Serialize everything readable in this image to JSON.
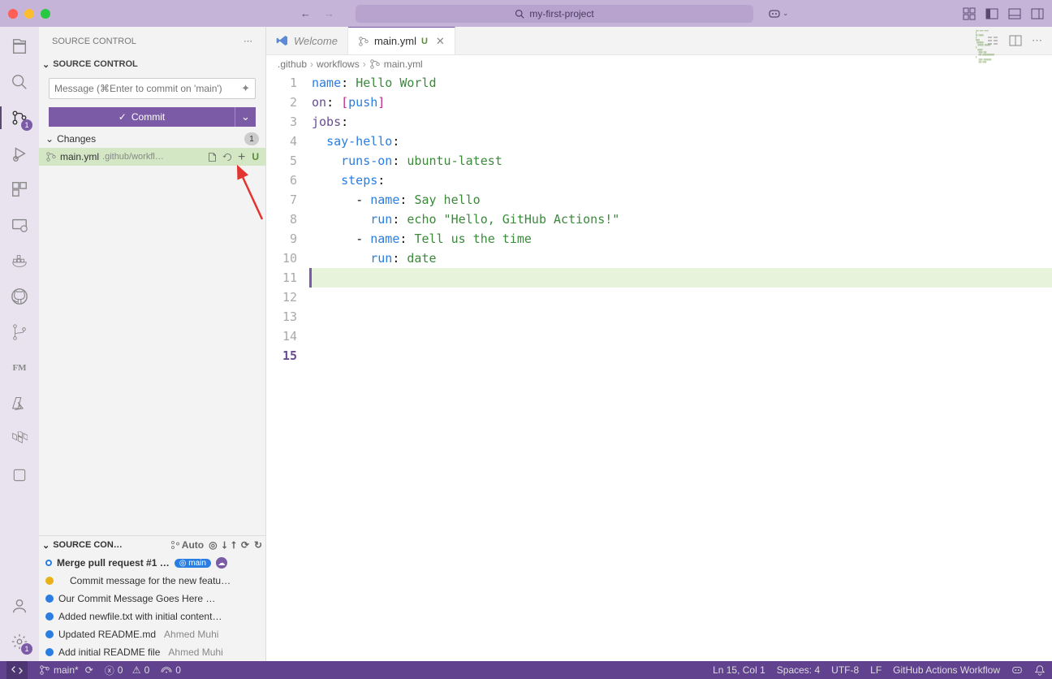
{
  "title": {
    "project": "my-first-project"
  },
  "tabs": {
    "welcome": "Welcome",
    "file": "main.yml",
    "file_status": "U"
  },
  "breadcrumb": {
    "a": ".github",
    "b": "workflows",
    "c": "main.yml"
  },
  "sidebar": {
    "title": "SOURCE CONTROL",
    "section": "SOURCE CONTROL",
    "msg_placeholder": "Message (⌘Enter to commit on 'main')",
    "commit_label": "Commit",
    "changes_label": "Changes",
    "changes_count": "1",
    "file": {
      "name": "main.yml",
      "path": ".github/workfl…",
      "status": "U"
    },
    "graph_title": "SOURCE CON…",
    "auto": "Auto",
    "commits": [
      {
        "msg": "Merge pull request #1 …",
        "dot": "hollow",
        "badge": "main"
      },
      {
        "msg": "Commit message for the new featu…",
        "dot": "yellow"
      },
      {
        "msg": "Our Commit Message Goes Here …",
        "dot": "blue"
      },
      {
        "msg": "Added newfile.txt with initial content…",
        "dot": "blue"
      },
      {
        "msg": "Updated README.md",
        "dot": "blue",
        "author": "Ahmed Muhi"
      },
      {
        "msg": "Add initial README file",
        "dot": "blue",
        "author": "Ahmed Muhi"
      }
    ]
  },
  "activity_badge": "1",
  "editor": {
    "lines": [
      [
        [
          "k-key",
          "name"
        ],
        [
          "k-punc",
          ": "
        ],
        [
          "k-str",
          "Hello World"
        ]
      ],
      [],
      [
        [
          "k-fn",
          "on"
        ],
        [
          "k-punc",
          ": "
        ],
        [
          "k-br",
          "["
        ],
        [
          "k-key",
          "push"
        ],
        [
          "k-br",
          "]"
        ]
      ],
      [],
      [
        [
          "k-fn",
          "jobs"
        ],
        [
          "k-punc",
          ":"
        ]
      ],
      [
        [
          "",
          "  "
        ],
        [
          "k-key",
          "say-hello"
        ],
        [
          "k-punc",
          ":"
        ]
      ],
      [
        [
          "",
          "    "
        ],
        [
          "k-key",
          "runs-on"
        ],
        [
          "k-punc",
          ": "
        ],
        [
          "k-str",
          "ubuntu-latest"
        ]
      ],
      [],
      [
        [
          "",
          "    "
        ],
        [
          "k-key",
          "steps"
        ],
        [
          "k-punc",
          ":"
        ]
      ],
      [
        [
          "",
          "      "
        ],
        [
          "k-punc",
          "- "
        ],
        [
          "k-key",
          "name"
        ],
        [
          "k-punc",
          ": "
        ],
        [
          "k-str",
          "Say hello"
        ]
      ],
      [
        [
          "",
          "        "
        ],
        [
          "k-key",
          "run"
        ],
        [
          "k-punc",
          ": "
        ],
        [
          "k-str",
          "echo \"Hello, GitHub Actions!\""
        ]
      ],
      [],
      [
        [
          "",
          "      "
        ],
        [
          "k-punc",
          "- "
        ],
        [
          "k-key",
          "name"
        ],
        [
          "k-punc",
          ": "
        ],
        [
          "k-str",
          "Tell us the time"
        ]
      ],
      [
        [
          "",
          "        "
        ],
        [
          "k-key",
          "run"
        ],
        [
          "k-punc",
          ": "
        ],
        [
          "k-str",
          "date"
        ]
      ],
      []
    ],
    "current_line": 15
  },
  "statusbar": {
    "branch": "main*",
    "errors": "0",
    "warnings": "0",
    "ports": "0",
    "cursor": "Ln 15, Col 1",
    "spaces": "Spaces: 4",
    "encoding": "UTF-8",
    "eol": "LF",
    "language": "GitHub Actions Workflow"
  }
}
